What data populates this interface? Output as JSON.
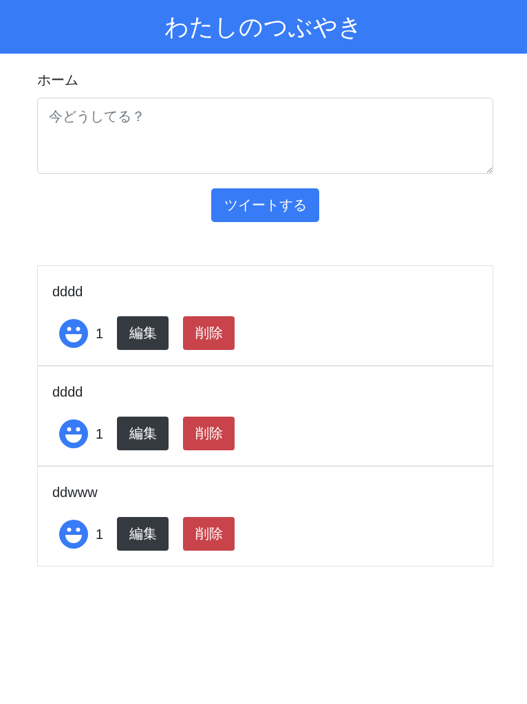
{
  "header": {
    "title": "わたしのつぶやき"
  },
  "section_label": "ホーム",
  "composer": {
    "placeholder": "今どうしてる？",
    "submit": "ツイートする"
  },
  "tweets": [
    {
      "text": "dddd",
      "likes": "1",
      "edit": "編集",
      "delete": "削除"
    },
    {
      "text": "dddd",
      "likes": "1",
      "edit": "編集",
      "delete": "削除"
    },
    {
      "text": "ddwww",
      "likes": "1",
      "edit": "編集",
      "delete": "削除"
    }
  ]
}
